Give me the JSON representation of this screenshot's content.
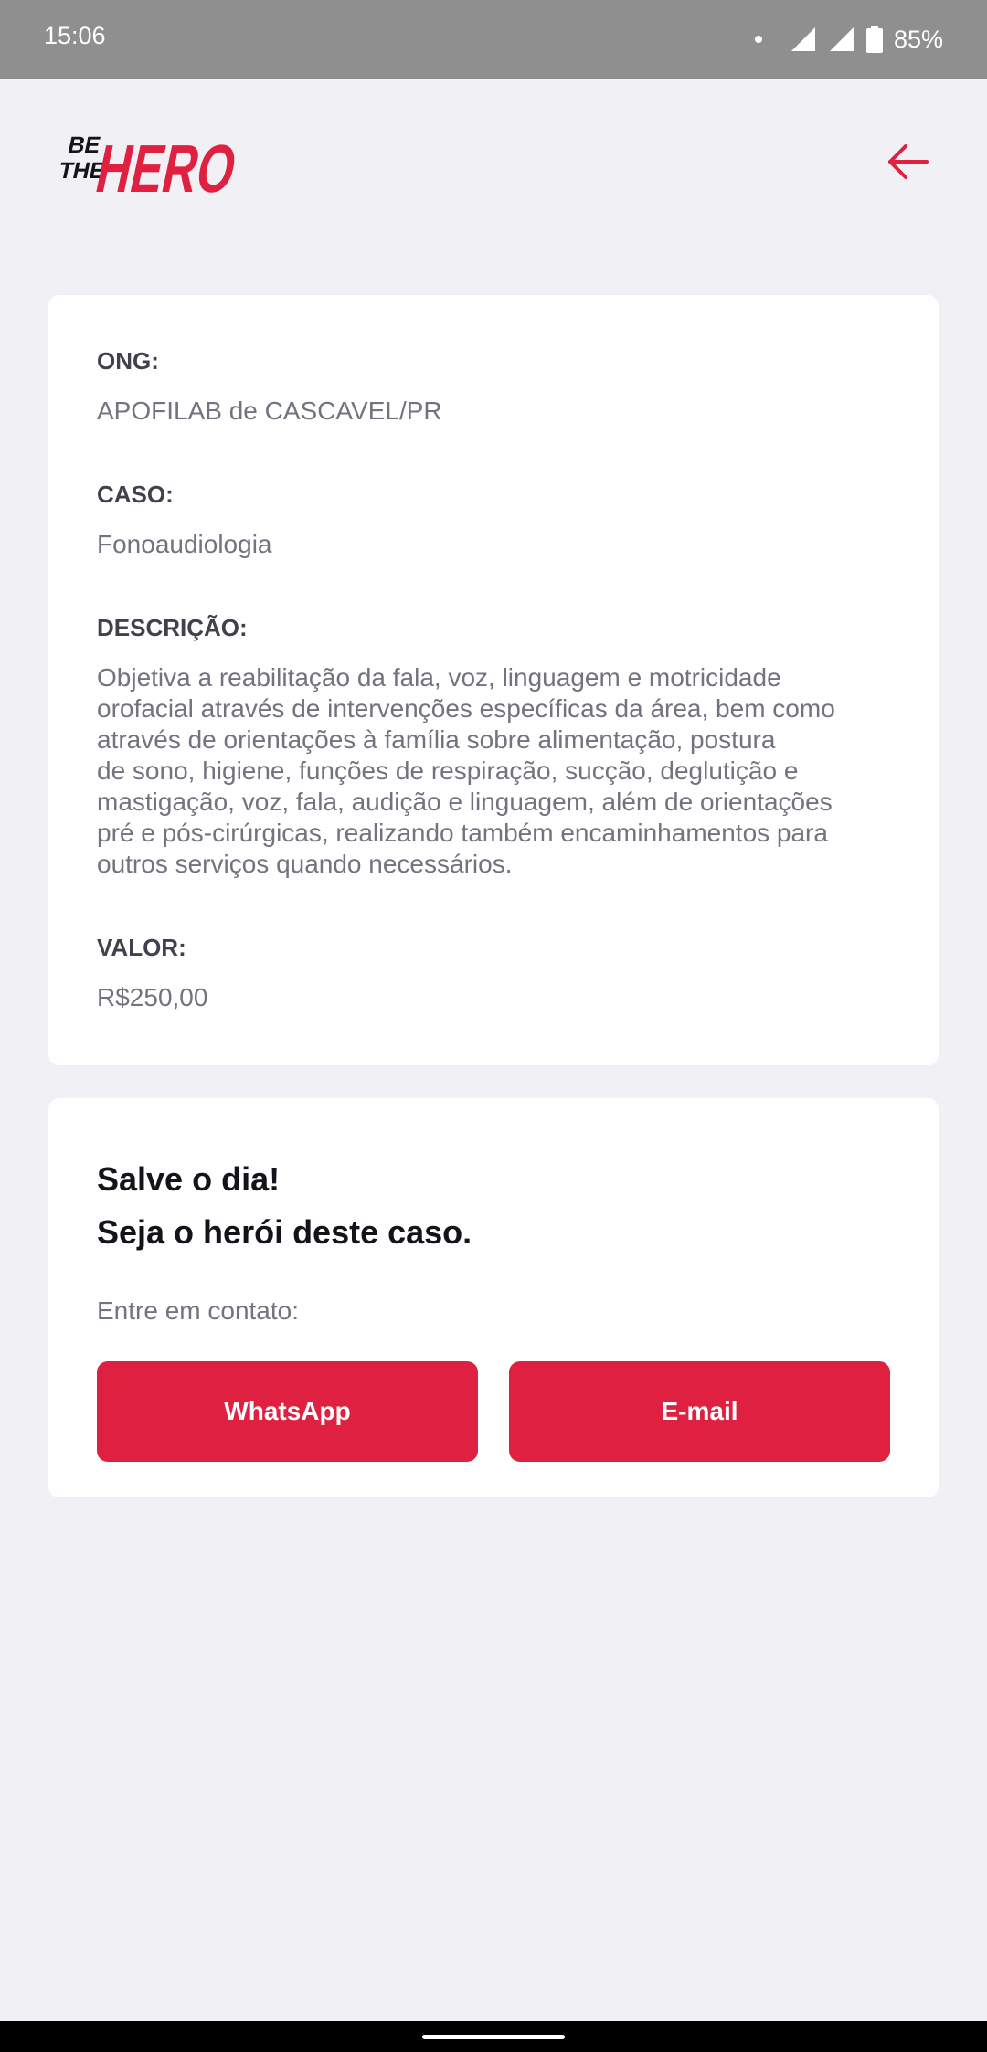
{
  "status_bar": {
    "time": "15:06",
    "battery": "85%"
  },
  "header": {
    "logo_text_small_1": "BE",
    "logo_text_small_2": "THE",
    "logo_text_big": "HERO",
    "brand_color": "#e02041",
    "back_icon": "arrow-left-icon"
  },
  "incident": {
    "ong_label": "ONG:",
    "ong_value": "APOFILAB de CASCAVEL/PR",
    "case_label": "CASO:",
    "case_value": "Fonoaudiologia",
    "description_label": "DESCRIÇÃO:",
    "description_lines": [
      "Objetiva a reabilitação da fala, voz, linguagem e motricidade",
      "orofacial através de intervenções específicas da área, bem como",
      "através de orientações à família sobre alimentação, postura",
      "de sono, higiene, funções de respiração, sucção, deglutição e",
      "mastigação, voz, fala, audição e linguagem, além de orientações",
      "pré e pós-cirúrgicas, realizando também encaminhamentos para",
      "outros serviços quando necessários."
    ],
    "value_label": "VALOR:",
    "value_value": "R$250,00"
  },
  "contact": {
    "title_line_1": "Salve o dia!",
    "title_line_2": "Seja o herói deste caso.",
    "label": "Entre em contato:",
    "whatsapp_label": "WhatsApp",
    "email_label": "E-mail"
  }
}
